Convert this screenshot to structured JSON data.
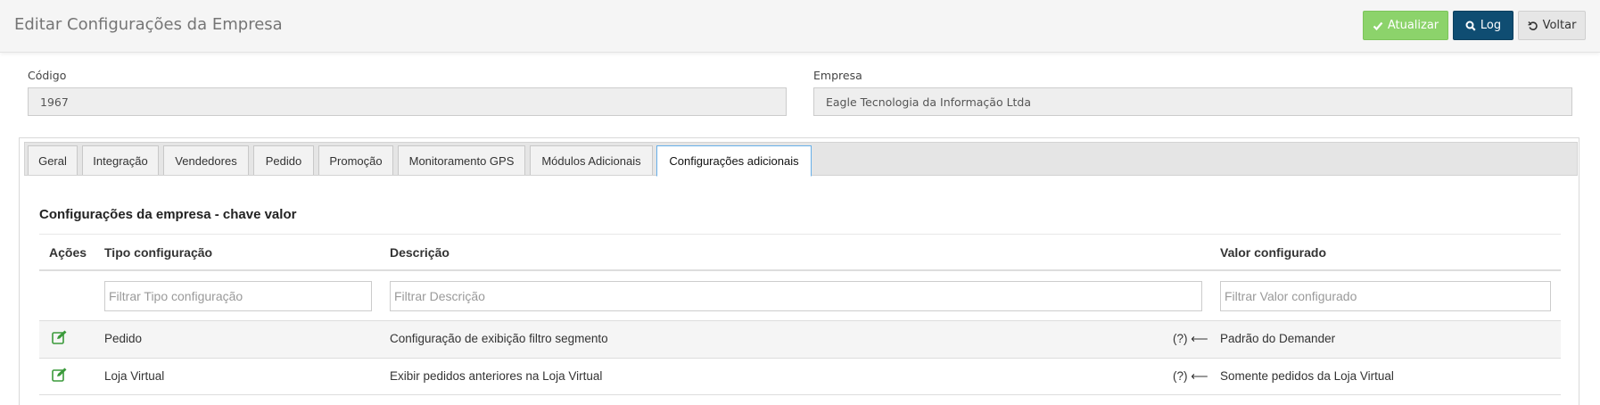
{
  "header": {
    "title": "Editar Configurações da Empresa",
    "buttons": {
      "atualizar": "Atualizar",
      "log": "Log",
      "voltar": "Voltar"
    }
  },
  "form": {
    "codigo_label": "Código",
    "codigo_value": "1967",
    "empresa_label": "Empresa",
    "empresa_value": "Eagle Tecnologia da Informação Ltda"
  },
  "tabs": [
    {
      "label": "Geral"
    },
    {
      "label": "Integração"
    },
    {
      "label": "Vendedores"
    },
    {
      "label": "Pedido"
    },
    {
      "label": "Promoção"
    },
    {
      "label": "Monitoramento GPS"
    },
    {
      "label": "Módulos Adicionais"
    },
    {
      "label": "Configurações adicionais",
      "active": true
    }
  ],
  "section": {
    "title": "Configurações da empresa - chave valor"
  },
  "table": {
    "headers": {
      "acoes": "Ações",
      "tipo": "Tipo configuração",
      "descricao": "Descrição",
      "valor": "Valor configurado"
    },
    "filters": {
      "tipo_placeholder": "Filtrar Tipo configuração",
      "descricao_placeholder": "Filtrar Descrição",
      "valor_placeholder": "Filtrar Valor configurado"
    },
    "rows": [
      {
        "tipo": "Pedido",
        "descricao": "Configuração de exibição filtro segmento",
        "help": "(?) ⟵",
        "valor": "Padrão do Demander"
      },
      {
        "tipo": "Loja Virtual",
        "descricao": "Exibir pedidos anteriores na Loja Virtual",
        "help": "(?) ⟵",
        "valor": "Somente pedidos da Loja Virtual"
      }
    ]
  },
  "colors": {
    "atualizar": "#8cd36b",
    "log": "#0f4d72",
    "voltar": "#e6e6e6",
    "active_tab_border": "#66afe9",
    "edit_icon": "#3a9a3a"
  }
}
